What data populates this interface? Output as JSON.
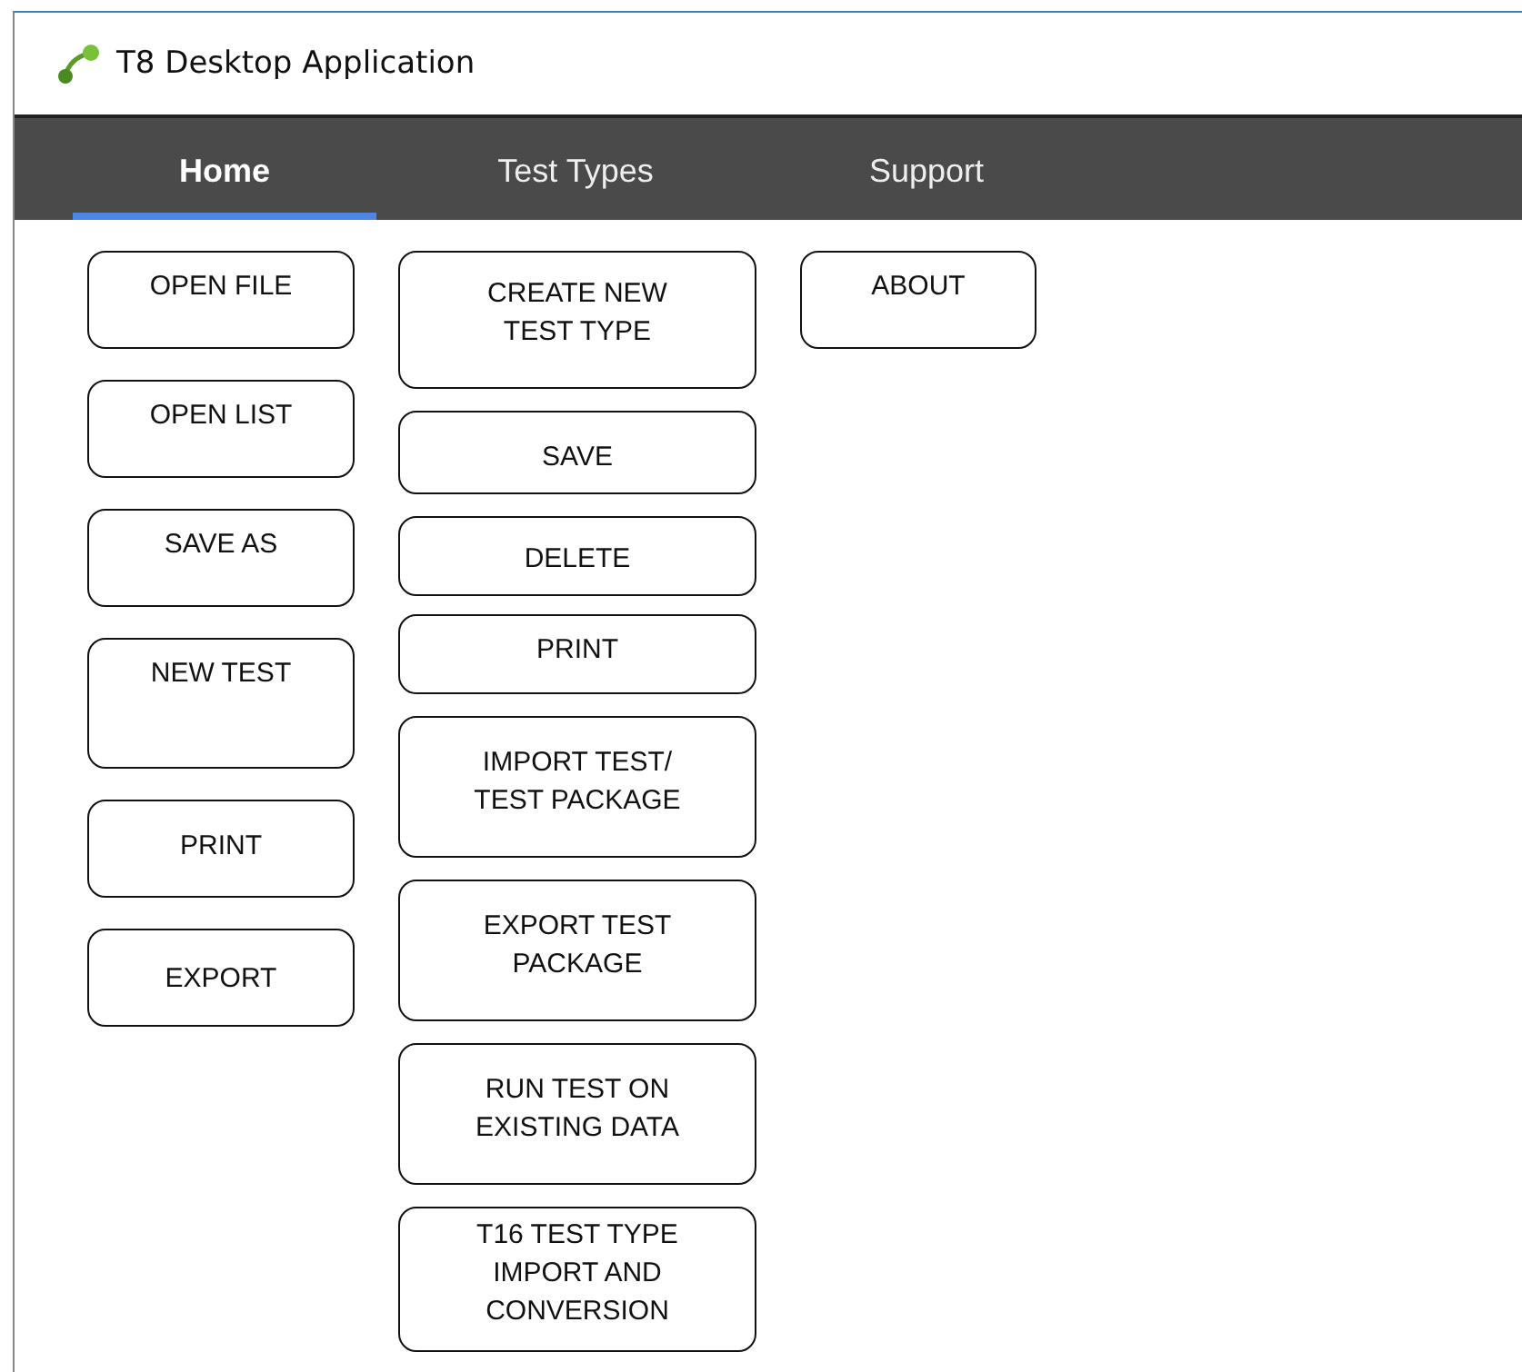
{
  "window": {
    "title": "T8 Desktop Application"
  },
  "tabs": [
    {
      "label": "Home",
      "selected": true
    },
    {
      "label": "Test Types",
      "selected": false
    },
    {
      "label": "Support",
      "selected": false
    }
  ],
  "columns": [
    {
      "buttons": [
        "OPEN FILE",
        "OPEN LIST",
        "SAVE AS",
        "NEW TEST",
        "PRINT",
        "EXPORT"
      ]
    },
    {
      "buttons": [
        "CREATE NEW\nTEST TYPE",
        "SAVE",
        "DELETE",
        "PRINT",
        "IMPORT TEST/\nTEST PACKAGE",
        "EXPORT TEST\nPACKAGE",
        "RUN TEST ON\nEXISTING DATA",
        "T16 TEST TYPE\nIMPORT AND\nCONVERSION"
      ]
    },
    {
      "buttons": [
        "ABOUT"
      ]
    }
  ]
}
